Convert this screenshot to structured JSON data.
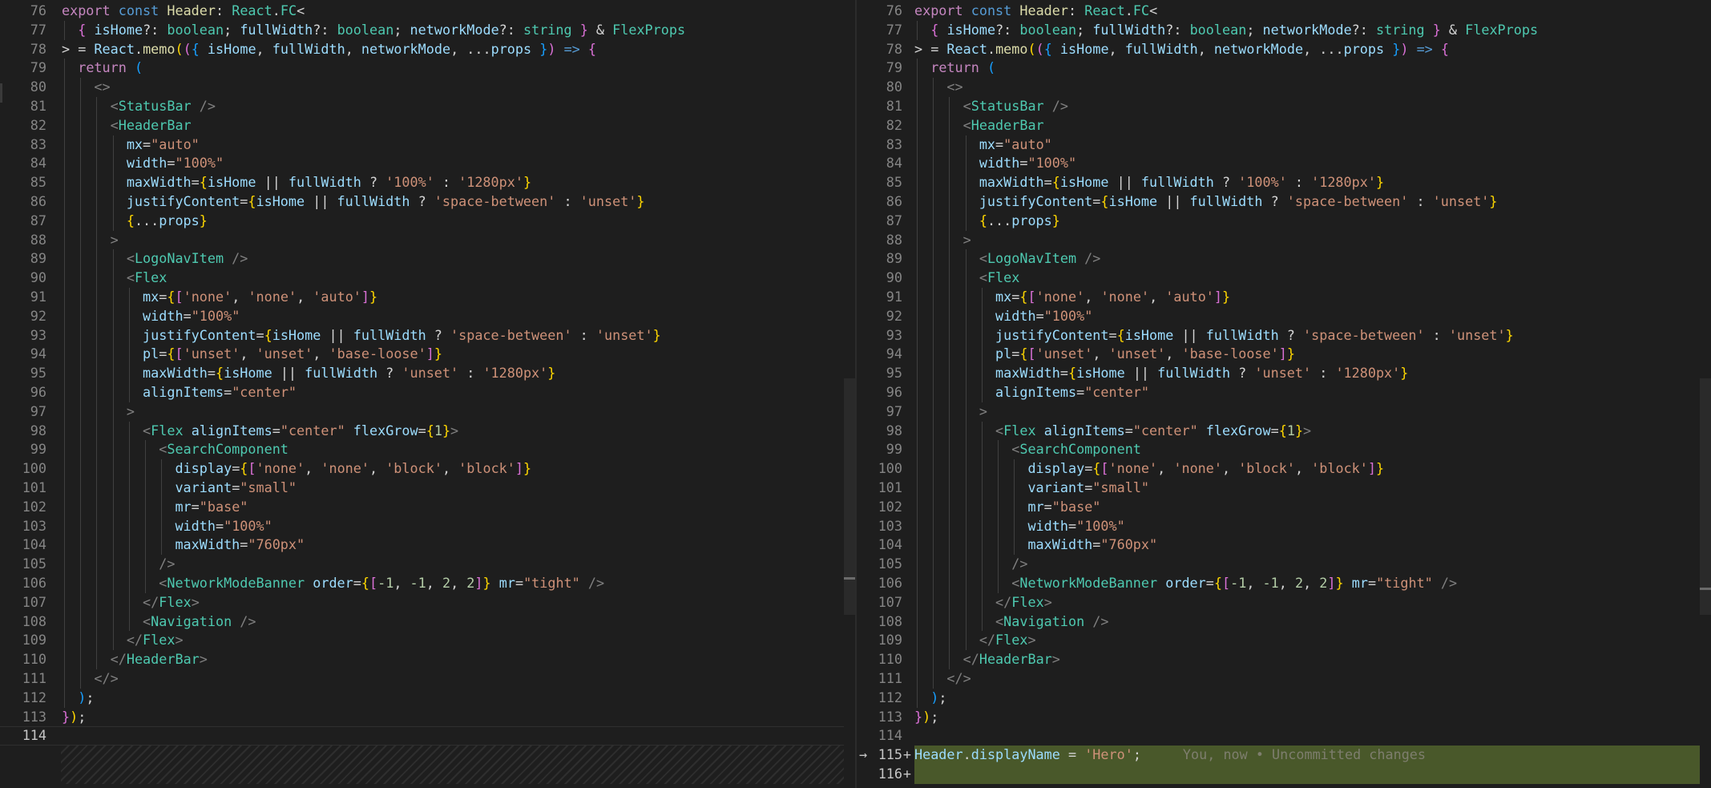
{
  "editor": {
    "colors": {
      "background": "#1e1e1e",
      "line_number": "#858585",
      "keyword": "#569cd6",
      "control_keyword": "#c586c0",
      "function": "#dcdcaa",
      "type": "#4ec9b0",
      "variable": "#9cdcfe",
      "string": "#ce9178",
      "number": "#b5cea8",
      "added_line_bg": "#49582a"
    },
    "code_lines": [
      [
        [
          "export",
          "kwc"
        ],
        [
          " ",
          ""
        ],
        [
          "const",
          "kw"
        ],
        [
          " ",
          ""
        ],
        [
          "Header",
          "fn"
        ],
        [
          ": ",
          ""
        ],
        [
          "React",
          "ty"
        ],
        [
          ".",
          ""
        ],
        [
          "FC",
          "ty"
        ],
        [
          "<",
          "pun"
        ]
      ],
      [
        [
          "  ",
          ""
        ],
        [
          "{",
          "b2"
        ],
        [
          " ",
          ""
        ],
        [
          "isHome",
          "var"
        ],
        [
          "?: ",
          ""
        ],
        [
          "boolean",
          "ty"
        ],
        [
          "; ",
          ""
        ],
        [
          "fullWidth",
          "var"
        ],
        [
          "?: ",
          ""
        ],
        [
          "boolean",
          "ty"
        ],
        [
          "; ",
          ""
        ],
        [
          "networkMode",
          "var"
        ],
        [
          "?: ",
          ""
        ],
        [
          "string",
          "ty"
        ],
        [
          " ",
          ""
        ],
        [
          "}",
          "b2"
        ],
        [
          " & ",
          ""
        ],
        [
          "FlexProps",
          "ty"
        ]
      ],
      [
        [
          "> = ",
          ""
        ],
        [
          "React",
          "var"
        ],
        [
          ".",
          ""
        ],
        [
          "memo",
          "fn"
        ],
        [
          "(",
          "b1"
        ],
        [
          "(",
          "b2"
        ],
        [
          "{",
          "b3"
        ],
        [
          " ",
          ""
        ],
        [
          "isHome",
          "var"
        ],
        [
          ", ",
          ""
        ],
        [
          "fullWidth",
          "var"
        ],
        [
          ", ",
          ""
        ],
        [
          "networkMode",
          "var"
        ],
        [
          ", ...",
          ""
        ],
        [
          "props",
          "var"
        ],
        [
          " ",
          ""
        ],
        [
          "}",
          "b3"
        ],
        [
          ")",
          "b2"
        ],
        [
          " ",
          ""
        ],
        [
          "=>",
          "kw"
        ],
        [
          " ",
          ""
        ],
        [
          "{",
          "b2"
        ]
      ],
      [
        [
          "  ",
          ""
        ],
        [
          "return",
          "kwc"
        ],
        [
          " ",
          ""
        ],
        [
          "(",
          "b3"
        ]
      ],
      [
        [
          "    ",
          ""
        ],
        [
          "<>",
          "brk"
        ]
      ],
      [
        [
          "      ",
          ""
        ],
        [
          "<",
          "brk"
        ],
        [
          "StatusBar",
          "tag"
        ],
        [
          " />",
          "brk"
        ]
      ],
      [
        [
          "      ",
          ""
        ],
        [
          "<",
          "brk"
        ],
        [
          "HeaderBar",
          "tag"
        ]
      ],
      [
        [
          "        ",
          ""
        ],
        [
          "mx",
          "var"
        ],
        [
          "=",
          ""
        ],
        [
          "\"auto\"",
          "str"
        ]
      ],
      [
        [
          "        ",
          ""
        ],
        [
          "width",
          "var"
        ],
        [
          "=",
          ""
        ],
        [
          "\"100%\"",
          "str"
        ]
      ],
      [
        [
          "        ",
          ""
        ],
        [
          "maxWidth",
          "var"
        ],
        [
          "=",
          ""
        ],
        [
          "{",
          "b1"
        ],
        [
          "isHome",
          "var"
        ],
        [
          " || ",
          ""
        ],
        [
          "fullWidth",
          "var"
        ],
        [
          " ? ",
          ""
        ],
        [
          "'100%'",
          "str"
        ],
        [
          " : ",
          ""
        ],
        [
          "'1280px'",
          "str"
        ],
        [
          "}",
          "b1"
        ]
      ],
      [
        [
          "        ",
          ""
        ],
        [
          "justifyContent",
          "var"
        ],
        [
          "=",
          ""
        ],
        [
          "{",
          "b1"
        ],
        [
          "isHome",
          "var"
        ],
        [
          " || ",
          ""
        ],
        [
          "fullWidth",
          "var"
        ],
        [
          " ? ",
          ""
        ],
        [
          "'space-between'",
          "str"
        ],
        [
          " : ",
          ""
        ],
        [
          "'unset'",
          "str"
        ],
        [
          "}",
          "b1"
        ]
      ],
      [
        [
          "        ",
          ""
        ],
        [
          "{",
          "b1"
        ],
        [
          "...",
          ""
        ],
        [
          "props",
          "var"
        ],
        [
          "}",
          "b1"
        ]
      ],
      [
        [
          "      ",
          ""
        ],
        [
          ">",
          "brk"
        ]
      ],
      [
        [
          "        ",
          ""
        ],
        [
          "<",
          "brk"
        ],
        [
          "LogoNavItem",
          "tag"
        ],
        [
          " />",
          "brk"
        ]
      ],
      [
        [
          "        ",
          ""
        ],
        [
          "<",
          "brk"
        ],
        [
          "Flex",
          "tag"
        ]
      ],
      [
        [
          "          ",
          ""
        ],
        [
          "mx",
          "var"
        ],
        [
          "=",
          ""
        ],
        [
          "{",
          "b1"
        ],
        [
          "[",
          "b2"
        ],
        [
          "'none'",
          "str"
        ],
        [
          ", ",
          ""
        ],
        [
          "'none'",
          "str"
        ],
        [
          ", ",
          ""
        ],
        [
          "'auto'",
          "str"
        ],
        [
          "]",
          "b2"
        ],
        [
          "}",
          "b1"
        ]
      ],
      [
        [
          "          ",
          ""
        ],
        [
          "width",
          "var"
        ],
        [
          "=",
          ""
        ],
        [
          "\"100%\"",
          "str"
        ]
      ],
      [
        [
          "          ",
          ""
        ],
        [
          "justifyContent",
          "var"
        ],
        [
          "=",
          ""
        ],
        [
          "{",
          "b1"
        ],
        [
          "isHome",
          "var"
        ],
        [
          " || ",
          ""
        ],
        [
          "fullWidth",
          "var"
        ],
        [
          " ? ",
          ""
        ],
        [
          "'space-between'",
          "str"
        ],
        [
          " : ",
          ""
        ],
        [
          "'unset'",
          "str"
        ],
        [
          "}",
          "b1"
        ]
      ],
      [
        [
          "          ",
          ""
        ],
        [
          "pl",
          "var"
        ],
        [
          "=",
          ""
        ],
        [
          "{",
          "b1"
        ],
        [
          "[",
          "b2"
        ],
        [
          "'unset'",
          "str"
        ],
        [
          ", ",
          ""
        ],
        [
          "'unset'",
          "str"
        ],
        [
          ", ",
          ""
        ],
        [
          "'base-loose'",
          "str"
        ],
        [
          "]",
          "b2"
        ],
        [
          "}",
          "b1"
        ]
      ],
      [
        [
          "          ",
          ""
        ],
        [
          "maxWidth",
          "var"
        ],
        [
          "=",
          ""
        ],
        [
          "{",
          "b1"
        ],
        [
          "isHome",
          "var"
        ],
        [
          " || ",
          ""
        ],
        [
          "fullWidth",
          "var"
        ],
        [
          " ? ",
          ""
        ],
        [
          "'unset'",
          "str"
        ],
        [
          " : ",
          ""
        ],
        [
          "'1280px'",
          "str"
        ],
        [
          "}",
          "b1"
        ]
      ],
      [
        [
          "          ",
          ""
        ],
        [
          "alignItems",
          "var"
        ],
        [
          "=",
          ""
        ],
        [
          "\"center\"",
          "str"
        ]
      ],
      [
        [
          "        ",
          ""
        ],
        [
          ">",
          "brk"
        ]
      ],
      [
        [
          "          ",
          ""
        ],
        [
          "<",
          "brk"
        ],
        [
          "Flex",
          "tag"
        ],
        [
          " ",
          ""
        ],
        [
          "alignItems",
          "var"
        ],
        [
          "=",
          ""
        ],
        [
          "\"center\"",
          "str"
        ],
        [
          " ",
          ""
        ],
        [
          "flexGrow",
          "var"
        ],
        [
          "=",
          ""
        ],
        [
          "{",
          "b1"
        ],
        [
          "1",
          "num"
        ],
        [
          "}",
          "b1"
        ],
        [
          ">",
          "brk"
        ]
      ],
      [
        [
          "            ",
          ""
        ],
        [
          "<",
          "brk"
        ],
        [
          "SearchComponent",
          "tag"
        ]
      ],
      [
        [
          "              ",
          ""
        ],
        [
          "display",
          "var"
        ],
        [
          "=",
          ""
        ],
        [
          "{",
          "b1"
        ],
        [
          "[",
          "b2"
        ],
        [
          "'none'",
          "str"
        ],
        [
          ", ",
          ""
        ],
        [
          "'none'",
          "str"
        ],
        [
          ", ",
          ""
        ],
        [
          "'block'",
          "str"
        ],
        [
          ", ",
          ""
        ],
        [
          "'block'",
          "str"
        ],
        [
          "]",
          "b2"
        ],
        [
          "}",
          "b1"
        ]
      ],
      [
        [
          "              ",
          ""
        ],
        [
          "variant",
          "var"
        ],
        [
          "=",
          ""
        ],
        [
          "\"small\"",
          "str"
        ]
      ],
      [
        [
          "              ",
          ""
        ],
        [
          "mr",
          "var"
        ],
        [
          "=",
          ""
        ],
        [
          "\"base\"",
          "str"
        ]
      ],
      [
        [
          "              ",
          ""
        ],
        [
          "width",
          "var"
        ],
        [
          "=",
          ""
        ],
        [
          "\"100%\"",
          "str"
        ]
      ],
      [
        [
          "              ",
          ""
        ],
        [
          "maxWidth",
          "var"
        ],
        [
          "=",
          ""
        ],
        [
          "\"760px\"",
          "str"
        ]
      ],
      [
        [
          "            ",
          ""
        ],
        [
          "/>",
          "brk"
        ]
      ],
      [
        [
          "            ",
          ""
        ],
        [
          "<",
          "brk"
        ],
        [
          "NetworkModeBanner",
          "tag"
        ],
        [
          " ",
          ""
        ],
        [
          "order",
          "var"
        ],
        [
          "=",
          ""
        ],
        [
          "{",
          "b1"
        ],
        [
          "[",
          "b2"
        ],
        [
          "-1",
          "num"
        ],
        [
          ", ",
          ""
        ],
        [
          "-1",
          "num"
        ],
        [
          ", ",
          ""
        ],
        [
          "2",
          "num"
        ],
        [
          ", ",
          ""
        ],
        [
          "2",
          "num"
        ],
        [
          "]",
          "b2"
        ],
        [
          "}",
          "b1"
        ],
        [
          " ",
          ""
        ],
        [
          "mr",
          "var"
        ],
        [
          "=",
          ""
        ],
        [
          "\"tight\"",
          "str"
        ],
        [
          " />",
          "brk"
        ]
      ],
      [
        [
          "          ",
          ""
        ],
        [
          "</",
          "brk"
        ],
        [
          "Flex",
          "tag"
        ],
        [
          ">",
          "brk"
        ]
      ],
      [
        [
          "          ",
          ""
        ],
        [
          "<",
          "brk"
        ],
        [
          "Navigation",
          "tag"
        ],
        [
          " />",
          "brk"
        ]
      ],
      [
        [
          "        ",
          ""
        ],
        [
          "</",
          "brk"
        ],
        [
          "Flex",
          "tag"
        ],
        [
          ">",
          "brk"
        ]
      ],
      [
        [
          "      ",
          ""
        ],
        [
          "</",
          "brk"
        ],
        [
          "HeaderBar",
          "tag"
        ],
        [
          ">",
          "brk"
        ]
      ],
      [
        [
          "    ",
          ""
        ],
        [
          "</>",
          "brk"
        ]
      ],
      [
        [
          "  ",
          ""
        ],
        [
          ")",
          "b3"
        ],
        [
          ";",
          ""
        ]
      ],
      [
        [
          "}",
          "b2"
        ],
        [
          ")",
          "b1"
        ],
        [
          ";",
          ""
        ]
      ]
    ],
    "left": {
      "line_numbers": [
        "76",
        "77",
        "78",
        "79",
        "80",
        "81",
        "82",
        "83",
        "84",
        "85",
        "86",
        "87",
        "88",
        "89",
        "90",
        "91",
        "92",
        "93",
        "94",
        "95",
        "96",
        "97",
        "98",
        "99",
        "100",
        "101",
        "102",
        "103",
        "104",
        "105",
        "106",
        "107",
        "108",
        "109",
        "110",
        "111",
        "112",
        "113",
        "114"
      ]
    },
    "right": {
      "line_numbers": [
        "76",
        "77",
        "78",
        "79",
        "80",
        "81",
        "82",
        "83",
        "84",
        "85",
        "86",
        "87",
        "88",
        "89",
        "90",
        "91",
        "92",
        "93",
        "94",
        "95",
        "96",
        "97",
        "98",
        "99",
        "100",
        "101",
        "102",
        "103",
        "104",
        "105",
        "106",
        "107",
        "108",
        "109",
        "110",
        "111",
        "112",
        "113",
        "114",
        "115",
        "116"
      ],
      "added_code": [
        [
          "Header",
          "var"
        ],
        [
          ".",
          ""
        ],
        [
          "displayName",
          "var"
        ],
        [
          " = ",
          ""
        ],
        [
          "'Hero'",
          "str"
        ],
        [
          ";",
          ""
        ]
      ],
      "blame": "You, now • Uncommitted changes",
      "add_marker": "+",
      "current_marker": "→"
    }
  }
}
